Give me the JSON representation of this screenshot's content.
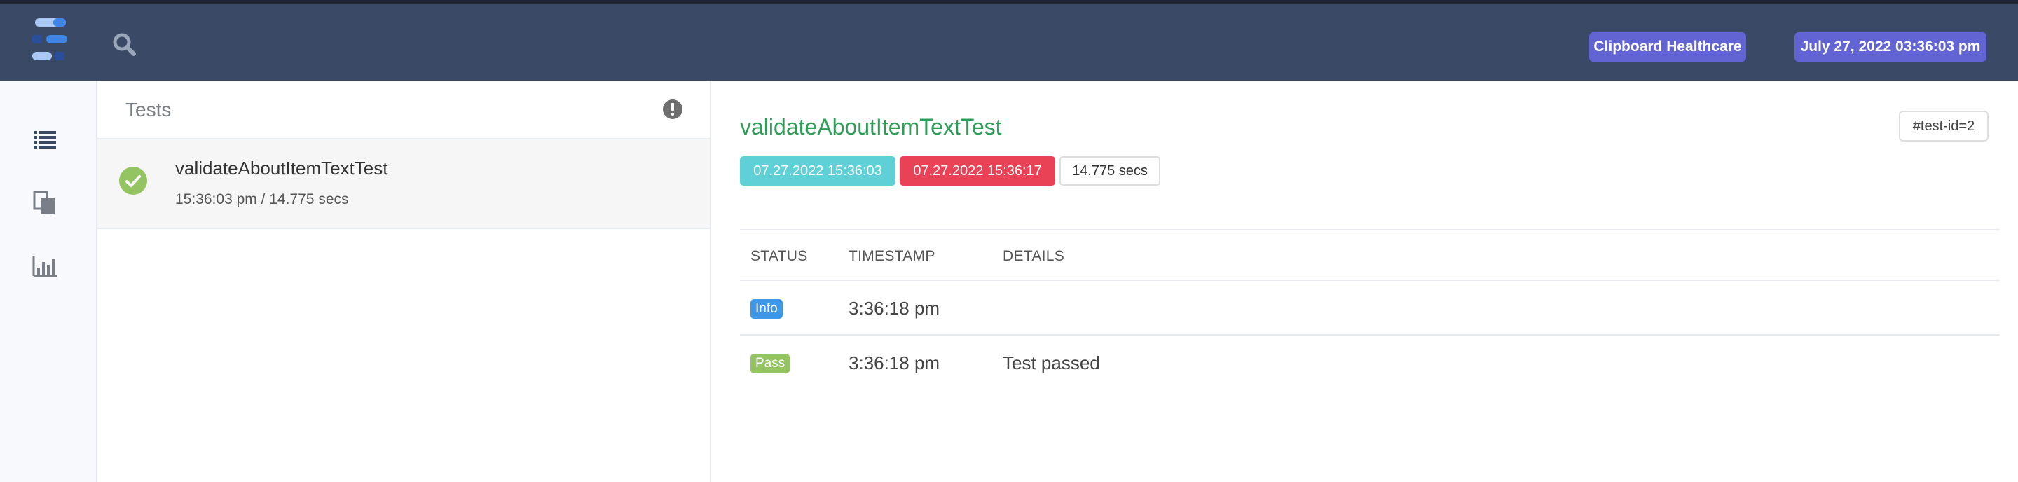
{
  "header": {
    "company": "Clipboard Healthcare",
    "datetime": "July 27, 2022 03:36:03 pm"
  },
  "sidebar": {
    "items": [
      {
        "icon": "list-icon"
      },
      {
        "icon": "copy-icon"
      },
      {
        "icon": "bar-chart-icon"
      }
    ]
  },
  "list_panel": {
    "title": "Tests",
    "tests": [
      {
        "name": "validateAboutItemTextTest",
        "meta": "15:36:03 pm / 14.775 secs",
        "status": "pass"
      }
    ]
  },
  "detail": {
    "title": "validateAboutItemTextTest",
    "test_id": "#test-id=2",
    "start": "07.27.2022 15:36:03",
    "end": "07.27.2022 15:36:17",
    "duration": "14.775 secs",
    "columns": [
      "STATUS",
      "TIMESTAMP",
      "DETAILS"
    ],
    "logs": [
      {
        "status": "Info",
        "timestamp": "3:36:18 pm",
        "details": ""
      },
      {
        "status": "Pass",
        "timestamp": "3:36:18 pm",
        "details": "Test passed"
      }
    ]
  },
  "colors": {
    "navbar": "#3a4966",
    "badge": "#6264d4",
    "title_green": "#2f9c57",
    "start_tag": "#5ed0d6",
    "end_tag": "#e94256",
    "info": "#3f97e8",
    "pass": "#94c462"
  }
}
